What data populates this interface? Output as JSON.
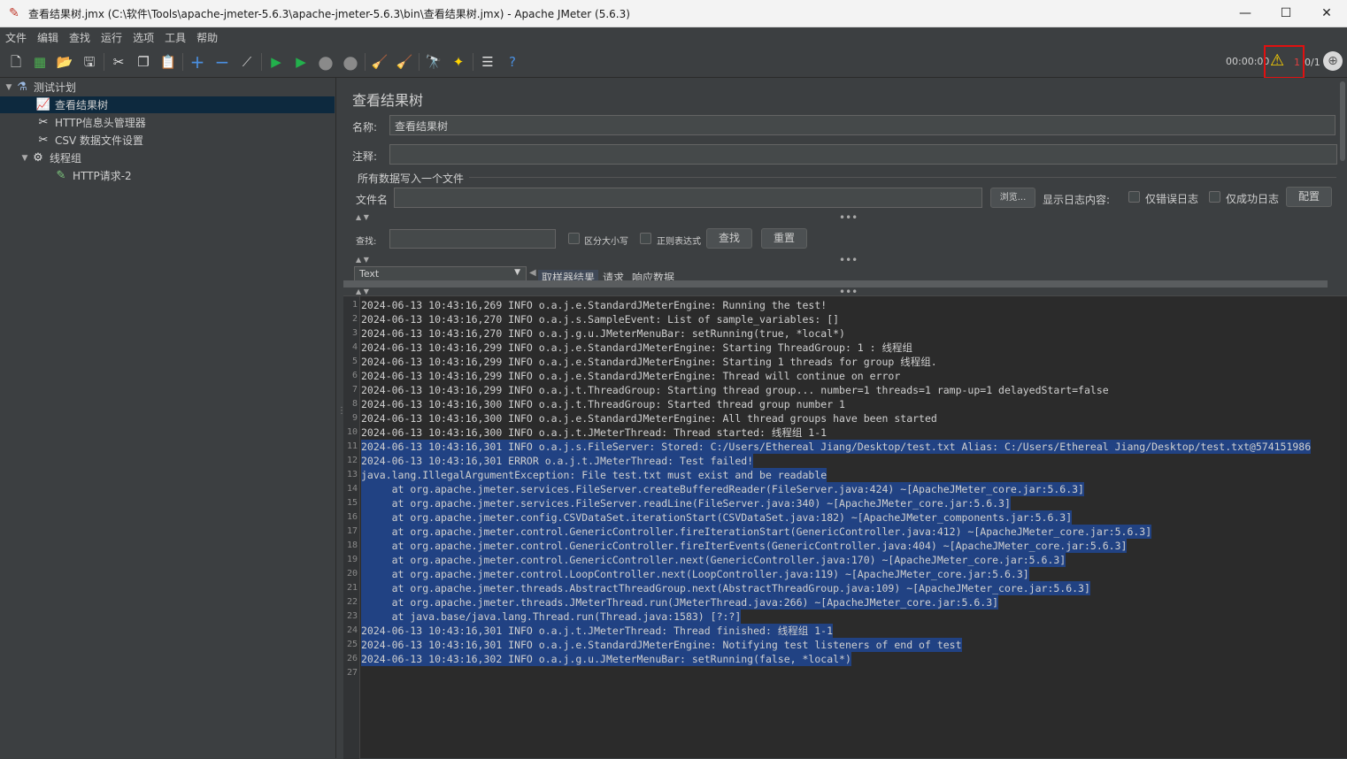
{
  "window": {
    "title": "查看结果树.jmx (C:\\软件\\Tools\\apache-jmeter-5.6.3\\apache-jmeter-5.6.3\\bin\\查看结果树.jmx) - Apache JMeter (5.6.3)",
    "minimize": "—",
    "maximize": "☐",
    "close": "✕"
  },
  "menu": [
    "文件",
    "编辑",
    "查找",
    "运行",
    "选项",
    "工具",
    "帮助"
  ],
  "toolbar": {
    "timer": "00:00:00",
    "warning_count": "1",
    "thread_count": "0/1"
  },
  "tree": [
    {
      "label": "测试计划",
      "icon": "flask-icon"
    },
    {
      "label": "查看结果树",
      "icon": "chart-icon"
    },
    {
      "label": "HTTP信息头管理器",
      "icon": "tools-icon"
    },
    {
      "label": "CSV 数据文件设置",
      "icon": "tools-icon"
    },
    {
      "label": "线程组",
      "icon": "gear-icon"
    },
    {
      "label": "HTTP请求-2",
      "icon": "pen-icon"
    }
  ],
  "panel": {
    "title": "查看结果树",
    "name_label": "名称:",
    "name_value": "查看结果树",
    "comment_label": "注释:",
    "comment_value": "",
    "file_section": "所有数据写入一个文件",
    "filename_label": "文件名",
    "filename_value": "",
    "browse_button": "浏览...",
    "log_display_label": "显示日志内容:",
    "errors_only": "仅错误日志",
    "success_only": "仅成功日志",
    "configure_button": "配置",
    "search_label": "查找:",
    "search_value": "",
    "case_sensitive": "区分大小写",
    "regex": "正则表达式",
    "find_button": "查找",
    "reset_button": "重置",
    "renderer_value": "Text",
    "tab_sampler": "取样器结果",
    "tab_request": "请求",
    "tab_response": "响应数据"
  },
  "log": {
    "selected_from": 11,
    "lines": [
      "2024-06-13 10:43:16,269 INFO o.a.j.e.StandardJMeterEngine: Running the test!",
      "2024-06-13 10:43:16,270 INFO o.a.j.s.SampleEvent: List of sample_variables: []",
      "2024-06-13 10:43:16,270 INFO o.a.j.g.u.JMeterMenuBar: setRunning(true, *local*)",
      "2024-06-13 10:43:16,299 INFO o.a.j.e.StandardJMeterEngine: Starting ThreadGroup: 1 : 线程组",
      "2024-06-13 10:43:16,299 INFO o.a.j.e.StandardJMeterEngine: Starting 1 threads for group 线程组.",
      "2024-06-13 10:43:16,299 INFO o.a.j.e.StandardJMeterEngine: Thread will continue on error",
      "2024-06-13 10:43:16,299 INFO o.a.j.t.ThreadGroup: Starting thread group... number=1 threads=1 ramp-up=1 delayedStart=false",
      "2024-06-13 10:43:16,300 INFO o.a.j.t.ThreadGroup: Started thread group number 1",
      "2024-06-13 10:43:16,300 INFO o.a.j.e.StandardJMeterEngine: All thread groups have been started",
      "2024-06-13 10:43:16,300 INFO o.a.j.t.JMeterThread: Thread started: 线程组 1-1",
      "2024-06-13 10:43:16,301 INFO o.a.j.s.FileServer: Stored: C:/Users/Ethereal Jiang/Desktop/test.txt Alias: C:/Users/Ethereal Jiang/Desktop/test.txt@574151986",
      "2024-06-13 10:43:16,301 ERROR o.a.j.t.JMeterThread: Test failed!",
      "java.lang.IllegalArgumentException: File test.txt must exist and be readable",
      "     at org.apache.jmeter.services.FileServer.createBufferedReader(FileServer.java:424) ~[ApacheJMeter_core.jar:5.6.3]",
      "     at org.apache.jmeter.services.FileServer.readLine(FileServer.java:340) ~[ApacheJMeter_core.jar:5.6.3]",
      "     at org.apache.jmeter.config.CSVDataSet.iterationStart(CSVDataSet.java:182) ~[ApacheJMeter_components.jar:5.6.3]",
      "     at org.apache.jmeter.control.GenericController.fireIterationStart(GenericController.java:412) ~[ApacheJMeter_core.jar:5.6.3]",
      "     at org.apache.jmeter.control.GenericController.fireIterEvents(GenericController.java:404) ~[ApacheJMeter_core.jar:5.6.3]",
      "     at org.apache.jmeter.control.GenericController.next(GenericController.java:170) ~[ApacheJMeter_core.jar:5.6.3]",
      "     at org.apache.jmeter.control.LoopController.next(LoopController.java:119) ~[ApacheJMeter_core.jar:5.6.3]",
      "     at org.apache.jmeter.threads.AbstractThreadGroup.next(AbstractThreadGroup.java:109) ~[ApacheJMeter_core.jar:5.6.3]",
      "     at org.apache.jmeter.threads.JMeterThread.run(JMeterThread.java:266) ~[ApacheJMeter_core.jar:5.6.3]",
      "     at java.base/java.lang.Thread.run(Thread.java:1583) [?:?]",
      "2024-06-13 10:43:16,301 INFO o.a.j.t.JMeterThread: Thread finished: 线程组 1-1",
      "2024-06-13 10:43:16,301 INFO o.a.j.e.StandardJMeterEngine: Notifying test listeners of end of test",
      "2024-06-13 10:43:16,302 INFO o.a.j.g.u.JMeterMenuBar: setRunning(false, *local*)",
      ""
    ]
  }
}
